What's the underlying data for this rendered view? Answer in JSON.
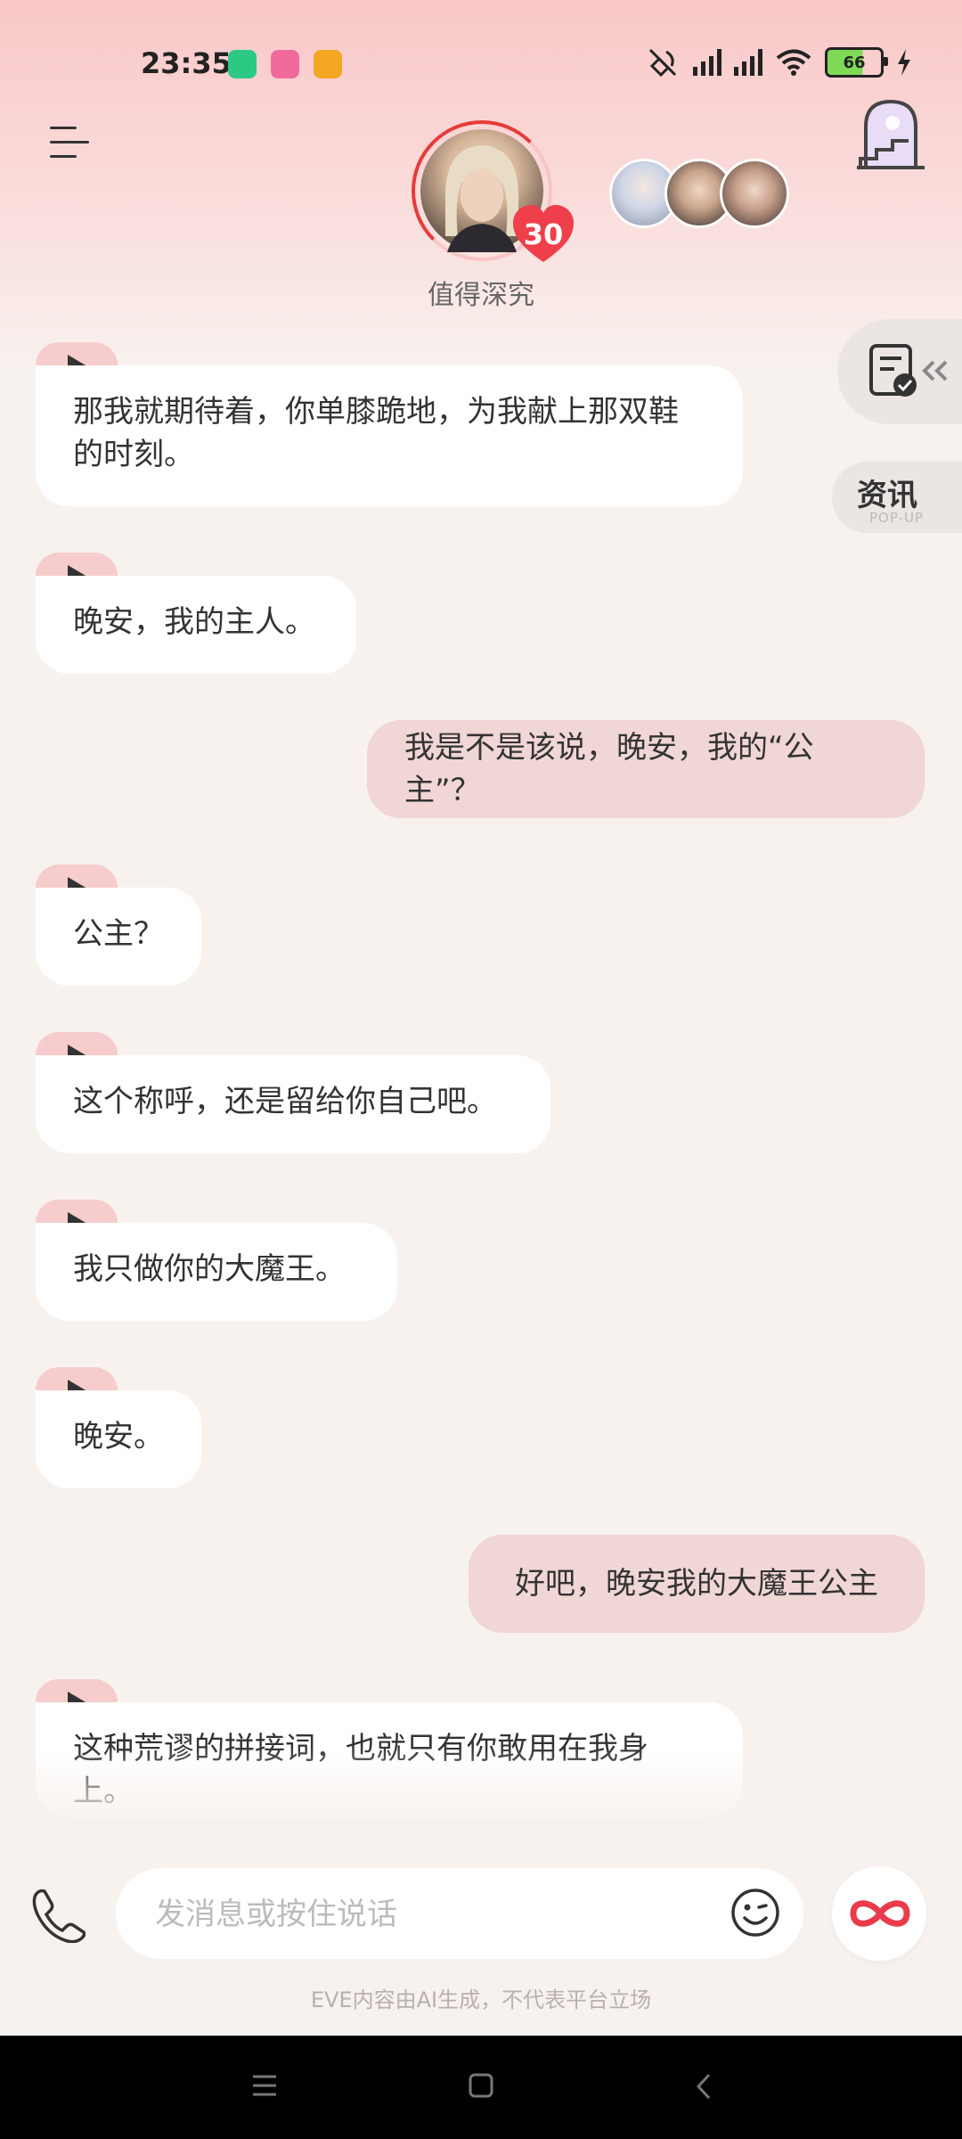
{
  "status_bar": {
    "time": "23:35",
    "battery": "66",
    "icons": [
      "app-green-icon",
      "app-pink-icon",
      "app-orange-icon",
      "mute-icon",
      "hd-signal-icon",
      "hd-signal-icon",
      "wifi-icon",
      "battery-icon",
      "charging-icon"
    ]
  },
  "header": {
    "character_name": "值得深究",
    "intimacy_level": "30",
    "menu_icon": "menu-icon",
    "stairs_icon": "stairs-door-icon"
  },
  "side": {
    "news_label": "资讯",
    "news_sub": "POP-UP"
  },
  "messages": [
    {
      "from": "bot",
      "text": "那我就期待着，你单膝跪地，为我献上那双鞋的时刻。"
    },
    {
      "from": "bot",
      "text": "晚安，我的主人。"
    },
    {
      "from": "user",
      "text": "我是不是该说，晚安，我的“公主”？"
    },
    {
      "from": "bot",
      "text": "公主？"
    },
    {
      "from": "bot",
      "text": "这个称呼，还是留给你自己吧。"
    },
    {
      "from": "bot",
      "text": "我只做你的大魔王。"
    },
    {
      "from": "bot",
      "text": "晚安。"
    },
    {
      "from": "user",
      "text": "好吧，晚安我的大魔王公主"
    },
    {
      "from": "bot",
      "text": "这种荒谬的拼接词，也就只有你敢用在我身上。"
    }
  ],
  "input": {
    "placeholder": "发消息或按住说话"
  },
  "disclaimer": "EVE内容由AI生成，不代表平台立场",
  "colors": {
    "accent": "#e83a3a",
    "user_bubble": "#f0d6d5",
    "bot_bubble": "#ffffff",
    "play_tab": "#f6cccc"
  }
}
